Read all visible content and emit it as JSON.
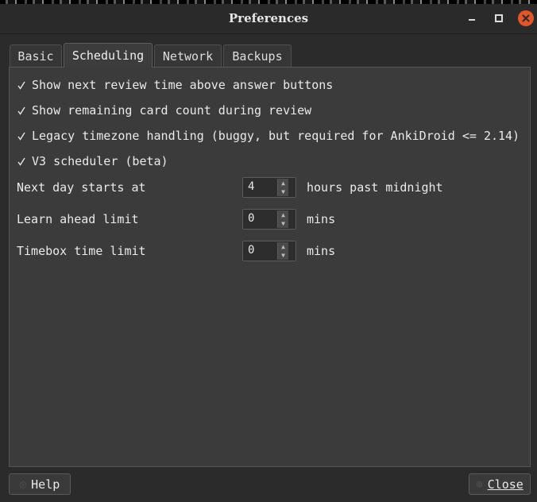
{
  "window": {
    "title": "Preferences"
  },
  "tabs": [
    {
      "label": "Basic"
    },
    {
      "label": "Scheduling"
    },
    {
      "label": "Network"
    },
    {
      "label": "Backups"
    }
  ],
  "checkboxes": [
    {
      "label": "Show next review time above answer buttons",
      "checked": true
    },
    {
      "label": "Show remaining card count during review",
      "checked": true
    },
    {
      "label": "Legacy timezone handling (buggy, but required for AnkiDroid <= 2.14)",
      "checked": true
    },
    {
      "label": "V3 scheduler (beta)",
      "checked": true
    }
  ],
  "rows": [
    {
      "label": "Next day starts at",
      "value": "4",
      "unit": "hours past midnight"
    },
    {
      "label": "Learn ahead limit",
      "value": "0",
      "unit": "mins"
    },
    {
      "label": "Timebox time limit",
      "value": "0",
      "unit": "mins"
    }
  ],
  "buttons": {
    "help": {
      "label": "Help",
      "icon": "help-icon"
    },
    "close": {
      "label": "Close",
      "icon": "close-icon"
    }
  },
  "colors": {
    "accent_close": "#e25526"
  }
}
